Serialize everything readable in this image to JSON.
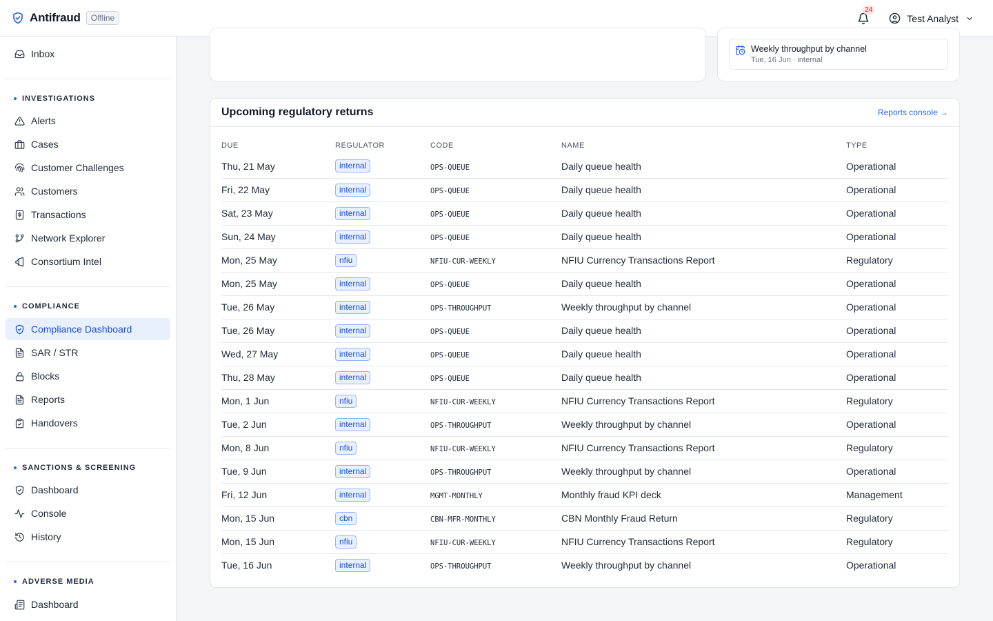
{
  "header": {
    "brand": "Antifraud",
    "status": "Offline",
    "notifications_count": "24",
    "user_name": "Test Analyst"
  },
  "sidebar": {
    "inbox": "Inbox",
    "sections": {
      "investigations": "INVESTIGATIONS",
      "compliance": "COMPLIANCE",
      "sanctions": "SANCTIONS & SCREENING",
      "adverse": "ADVERSE MEDIA"
    },
    "investigations": [
      "Alerts",
      "Cases",
      "Customer Challenges",
      "Customers",
      "Transactions",
      "Network Explorer",
      "Consortium Intel"
    ],
    "compliance": [
      "Compliance Dashboard",
      "SAR / STR",
      "Blocks",
      "Reports",
      "Handovers"
    ],
    "sanctions": [
      "Dashboard",
      "Console",
      "History"
    ],
    "adverse": [
      "Dashboard"
    ],
    "active_item": "Compliance Dashboard"
  },
  "schedule_card": {
    "item_title": "Weekly throughput by channel",
    "item_sub": "Tue, 16 Jun · internal"
  },
  "returns": {
    "title": "Upcoming regulatory returns",
    "link": "Reports console →",
    "columns": [
      "DUE",
      "REGULATOR",
      "CODE",
      "NAME",
      "TYPE"
    ],
    "rows": [
      [
        "Thu, 21 May",
        "internal",
        "OPS-QUEUE",
        "Daily queue health",
        "Operational"
      ],
      [
        "Fri, 22 May",
        "internal",
        "OPS-QUEUE",
        "Daily queue health",
        "Operational"
      ],
      [
        "Sat, 23 May",
        "internal",
        "OPS-QUEUE",
        "Daily queue health",
        "Operational"
      ],
      [
        "Sun, 24 May",
        "internal",
        "OPS-QUEUE",
        "Daily queue health",
        "Operational"
      ],
      [
        "Mon, 25 May",
        "nfiu",
        "NFIU-CUR-WEEKLY",
        "NFIU Currency Transactions Report",
        "Regulatory"
      ],
      [
        "Mon, 25 May",
        "internal",
        "OPS-QUEUE",
        "Daily queue health",
        "Operational"
      ],
      [
        "Tue, 26 May",
        "internal",
        "OPS-THROUGHPUT",
        "Weekly throughput by channel",
        "Operational"
      ],
      [
        "Tue, 26 May",
        "internal",
        "OPS-QUEUE",
        "Daily queue health",
        "Operational"
      ],
      [
        "Wed, 27 May",
        "internal",
        "OPS-QUEUE",
        "Daily queue health",
        "Operational"
      ],
      [
        "Thu, 28 May",
        "internal",
        "OPS-QUEUE",
        "Daily queue health",
        "Operational"
      ],
      [
        "Mon, 1 Jun",
        "nfiu",
        "NFIU-CUR-WEEKLY",
        "NFIU Currency Transactions Report",
        "Regulatory"
      ],
      [
        "Tue, 2 Jun",
        "internal",
        "OPS-THROUGHPUT",
        "Weekly throughput by channel",
        "Operational"
      ],
      [
        "Mon, 8 Jun",
        "nfiu",
        "NFIU-CUR-WEEKLY",
        "NFIU Currency Transactions Report",
        "Regulatory"
      ],
      [
        "Tue, 9 Jun",
        "internal",
        "OPS-THROUGHPUT",
        "Weekly throughput by channel",
        "Operational"
      ],
      [
        "Fri, 12 Jun",
        "internal",
        "MGMT-MONTHLY",
        "Monthly fraud KPI deck",
        "Management"
      ],
      [
        "Mon, 15 Jun",
        "cbn",
        "CBN-MFR-MONTHLY",
        "CBN Monthly Fraud Return",
        "Regulatory"
      ],
      [
        "Mon, 15 Jun",
        "nfiu",
        "NFIU-CUR-WEEKLY",
        "NFIU Currency Transactions Report",
        "Regulatory"
      ],
      [
        "Tue, 16 Jun",
        "internal",
        "OPS-THROUGHPUT",
        "Weekly throughput by channel",
        "Operational"
      ]
    ]
  },
  "colors": {
    "accent": "#2563eb",
    "active_bg": "#e8f0fd",
    "border": "#e5e7eb",
    "page_bg": "#f4f5f7",
    "badge_red": "#dc2626"
  }
}
